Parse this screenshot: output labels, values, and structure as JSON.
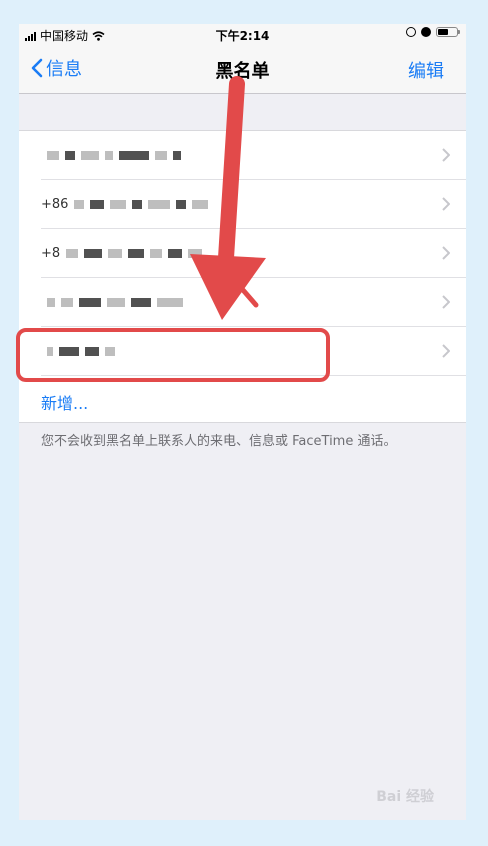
{
  "status_bar": {
    "carrier": "中国移动",
    "time": "下午2:14"
  },
  "nav": {
    "back_label": "信息",
    "title": "黑名单",
    "edit_label": "编辑"
  },
  "blocked_list": {
    "rows": [
      {
        "text": ""
      },
      {
        "text": "+86"
      },
      {
        "text": "+8"
      },
      {
        "text": ""
      },
      {
        "text": ""
      }
    ],
    "add_label": "新增..."
  },
  "footer_text": "您不会收到黑名单上联系人的来电、信息或 FaceTime 通话。",
  "watermark": "Bai 经验",
  "colors": {
    "accent": "#1a7cf5",
    "annotation": "#e24a4a"
  }
}
